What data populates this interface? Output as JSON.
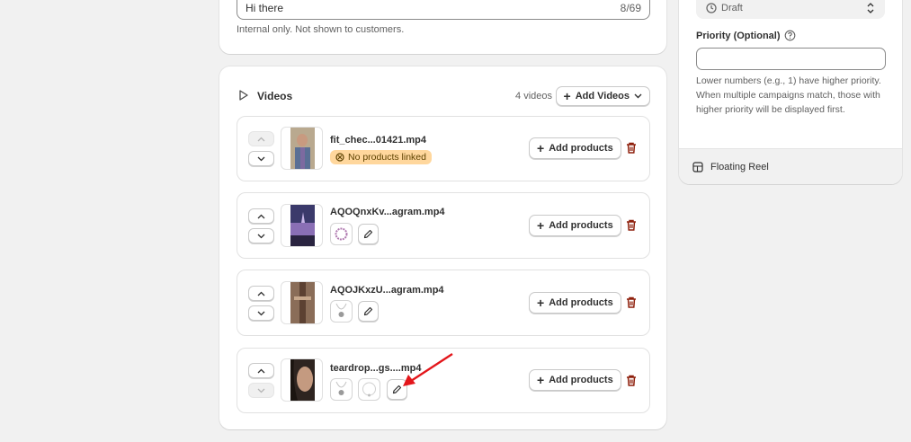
{
  "message_field": {
    "value": "Hi there",
    "counter": "8/69",
    "help": "Internal only. Not shown to customers."
  },
  "videos_section": {
    "title": "Videos",
    "count_label": "4 videos",
    "add_videos_label": "Add Videos",
    "add_products_label": "Add products",
    "items": [
      {
        "filename": "fit_chec...01421.mp4",
        "badge": "No products linked"
      },
      {
        "filename": "AQOQnxKv...agram.mp4"
      },
      {
        "filename": "AQOJKxzU...agram.mp4"
      },
      {
        "filename": "teardrop...gs....mp4"
      }
    ]
  },
  "sidebar": {
    "status_value": "Draft",
    "priority_label": "Priority (Optional)",
    "priority_value": "",
    "priority_help": "Lower numbers (e.g., 1) have higher priority. When multiple campaigns match, those with higher priority will be displayed first.",
    "footer_label": "Floating Reel"
  },
  "colors": {
    "badge_bg": "#ffd79d",
    "danger": "#8e1f0b",
    "annotation": "#e3161b"
  }
}
